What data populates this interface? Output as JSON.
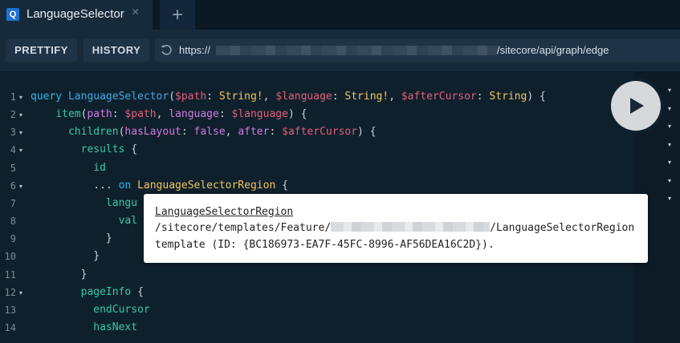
{
  "tab": {
    "logo": "Q",
    "title": "LanguageSelector",
    "close": "×",
    "add": "+"
  },
  "toolbar": {
    "prettify": "PRETTIFY",
    "history": "HISTORY",
    "url_prefix": "https://",
    "url_suffix": "/sitecore/api/graph/edge"
  },
  "editor": {
    "lines": [
      {
        "n": "1",
        "fold": true
      },
      {
        "n": "2",
        "fold": true
      },
      {
        "n": "3",
        "fold": true
      },
      {
        "n": "4",
        "fold": true
      },
      {
        "n": "5",
        "fold": false
      },
      {
        "n": "6",
        "fold": true
      },
      {
        "n": "7",
        "fold": false
      },
      {
        "n": "8",
        "fold": false
      },
      {
        "n": "9",
        "fold": false
      },
      {
        "n": "10",
        "fold": false
      },
      {
        "n": "11",
        "fold": false
      },
      {
        "n": "12",
        "fold": true
      },
      {
        "n": "13",
        "fold": false
      },
      {
        "n": "14",
        "fold": false
      }
    ],
    "code": {
      "l1": {
        "kw": "query",
        "name": "LanguageSelector",
        "p1": "$path",
        "t1": "String!",
        "p2": "$language",
        "t2": "String!",
        "p3": "$afterCursor",
        "t3": "String"
      },
      "l2": {
        "field": "item",
        "a1": "path",
        "v1": "$path",
        "a2": "language",
        "v2": "$language"
      },
      "l3": {
        "field": "children",
        "a1": "hasLayout",
        "b1": "false",
        "a2": "after",
        "v2": "$afterCursor"
      },
      "l4": {
        "field": "results"
      },
      "l5": {
        "field": "id"
      },
      "l6": {
        "spread": "...",
        "kw": "on",
        "type": "LanguageSelectorRegion"
      },
      "l7": {
        "partial": "langu"
      },
      "l8": {
        "partial": "val"
      },
      "l13": {
        "field": "endCursor"
      },
      "l14": {
        "field": "hasNext"
      },
      "l12": {
        "field": "pageInfo"
      }
    }
  },
  "tooltip": {
    "title": "LanguageSelectorRegion",
    "path_prefix": "/sitecore/templates/Feature/",
    "path_suffix": "/LanguageSelectorRegion",
    "line3": "template (ID: {BC186973-EA7F-45FC-8996-AF56DEA16C2D})."
  },
  "right_carets": [
    "▾",
    "▾",
    "▾",
    "▾",
    "▾",
    "▾",
    "▾"
  ]
}
